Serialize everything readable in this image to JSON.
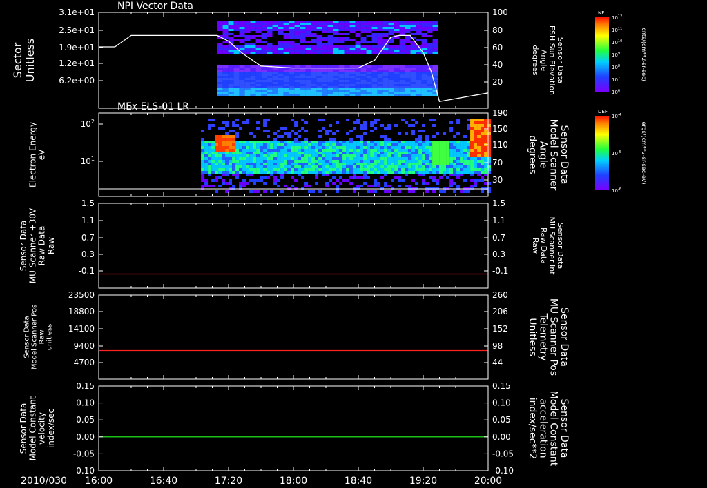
{
  "date_label": "2010/030",
  "time_ticks": [
    "16:00",
    "16:40",
    "17:20",
    "18:00",
    "18:40",
    "19:20",
    "20:00"
  ],
  "panels": [
    {
      "title": "NPI Vector Data",
      "left_label": [
        "Sector",
        "Unitless"
      ],
      "left_ticks": [
        "3.1e+01",
        "2.5e+01",
        "1.9e+01",
        "1.2e+01",
        "6.2e+00"
      ],
      "right_label": [
        "Sensor Data",
        "ESH Sun Elevation",
        "Angle",
        "degrees"
      ],
      "right_ticks": [
        "100",
        "80",
        "60",
        "40",
        "20"
      ],
      "right_color": "#ffffff"
    },
    {
      "title": "MEx ELS-01 LR",
      "left_label": [
        "Electron Energy",
        "eV"
      ],
      "left_ticks": [
        "10^2",
        "10^1"
      ],
      "right_label": [
        "Sensor Data",
        "Model Scanner",
        "Angle",
        "degrees"
      ],
      "right_ticks": [
        "190",
        "150",
        "110",
        "70",
        "30"
      ],
      "right_color": "#ffffff"
    },
    {
      "title": "",
      "left_label": [
        "Sensor Data",
        "MU Scanner +30V",
        "Raw Data",
        "Raw"
      ],
      "left_ticks": [
        "1.5",
        "1.1",
        "0.7",
        "0.3",
        "-0.1"
      ],
      "right_label": [
        "Sensor Data",
        "MU Scanner Int",
        "Raw Data",
        "Raw"
      ],
      "right_ticks": [
        "1.5",
        "1.1",
        "0.7",
        "0.3",
        "-0.1"
      ],
      "right_color": "#ff2020"
    },
    {
      "title": "",
      "left_label": [
        "Sensor Data",
        "Model Scanner Pos",
        "Raw",
        "unitless"
      ],
      "left_ticks": [
        "23500",
        "18800",
        "14100",
        "9400",
        "4700"
      ],
      "right_label": [
        "Sensor Data",
        "MU Scanner Pos",
        "Telemetry",
        "Unitless"
      ],
      "right_ticks": [
        "260",
        "206",
        "152",
        "98",
        "44"
      ],
      "right_color": "#ff2020"
    },
    {
      "title": "",
      "left_label": [
        "Sensor Data",
        "Model Constant",
        "velocity",
        "index/sec"
      ],
      "left_ticks": [
        "0.15",
        "0.10",
        "0.05",
        "0.00",
        "-0.05",
        "-0.10"
      ],
      "right_label": [
        "Sensor Data",
        "Model Constant",
        "acceleration",
        "index/sec**2"
      ],
      "right_ticks": [
        "0.15",
        "0.10",
        "0.05",
        "0.00",
        "-0.05",
        "-0.10"
      ],
      "right_color": "#20ff20"
    }
  ],
  "colorbars": [
    {
      "name": "NF",
      "units": "cnts/(cm**2-sr-sec)",
      "ticks": [
        "10^12",
        "10^11",
        "10^10",
        "10^9",
        "10^8",
        "10^7",
        "10^6"
      ]
    },
    {
      "name": "DEF",
      "units": "ergs/(cm**2-sr-sec-eV)",
      "ticks": [
        "10^-4",
        "10^-5",
        "10^-6"
      ]
    }
  ],
  "chart_data": [
    {
      "type": "line",
      "title": "NPI Vector Data",
      "x": [
        "16:00",
        "16:10",
        "16:20",
        "16:40",
        "17:00",
        "17:13",
        "17:20",
        "17:28",
        "17:40",
        "18:00",
        "18:20",
        "18:40",
        "18:50",
        "19:00",
        "19:05",
        "19:12",
        "19:20",
        "19:25",
        "19:30",
        "19:40",
        "20:00"
      ],
      "series": [
        {
          "name": "ESH Sun Elevation Angle",
          "color": "#ffffff",
          "values": [
            64,
            64,
            76,
            76,
            76,
            76,
            70,
            58,
            44,
            42,
            42,
            42,
            50,
            74,
            76,
            76,
            58,
            38,
            7,
            10,
            16
          ]
        }
      ],
      "ylim": [
        0,
        100
      ],
      "spectrogram": {
        "x_start": "17:13",
        "x_end": "19:27",
        "bands_y": [
          6.2,
          12,
          19,
          25,
          31
        ],
        "colormap": [
          "#6a00ff",
          "#2040ff",
          "#00c8ff",
          "#20ff80",
          "#ffff00",
          "#ff3000"
        ]
      }
    },
    {
      "type": "heatmap",
      "title": "MEx ELS-01 LR",
      "x_start": "17:03",
      "x_end": "20:00",
      "ylabel": "Electron Energy eV",
      "ylim": [
        1,
        150
      ],
      "series": [
        {
          "name": "Model Scanner Angle",
          "values": [
            20,
            20
          ],
          "x": [
            "16:00",
            "20:00"
          ]
        }
      ]
    },
    {
      "type": "line",
      "x": [
        "16:00",
        "20:00"
      ],
      "series": [
        {
          "name": "MU Scanner +30V",
          "color": "#ff2020",
          "values": [
            0.0,
            0.0
          ]
        }
      ],
      "ylim": [
        -0.3,
        1.5
      ]
    },
    {
      "type": "line",
      "x": [
        "16:00",
        "20:00"
      ],
      "series": [
        {
          "name": "Model Scanner Pos",
          "color": "#ff2020",
          "values": [
            8000,
            8000
          ]
        }
      ],
      "ylim": [
        0,
        23500
      ]
    },
    {
      "type": "line",
      "x": [
        "16:00",
        "20:00"
      ],
      "series": [
        {
          "name": "Model Constant velocity",
          "color": "#20ff20",
          "values": [
            0.0,
            0.0
          ]
        }
      ],
      "ylim": [
        -0.1,
        0.15
      ]
    }
  ]
}
